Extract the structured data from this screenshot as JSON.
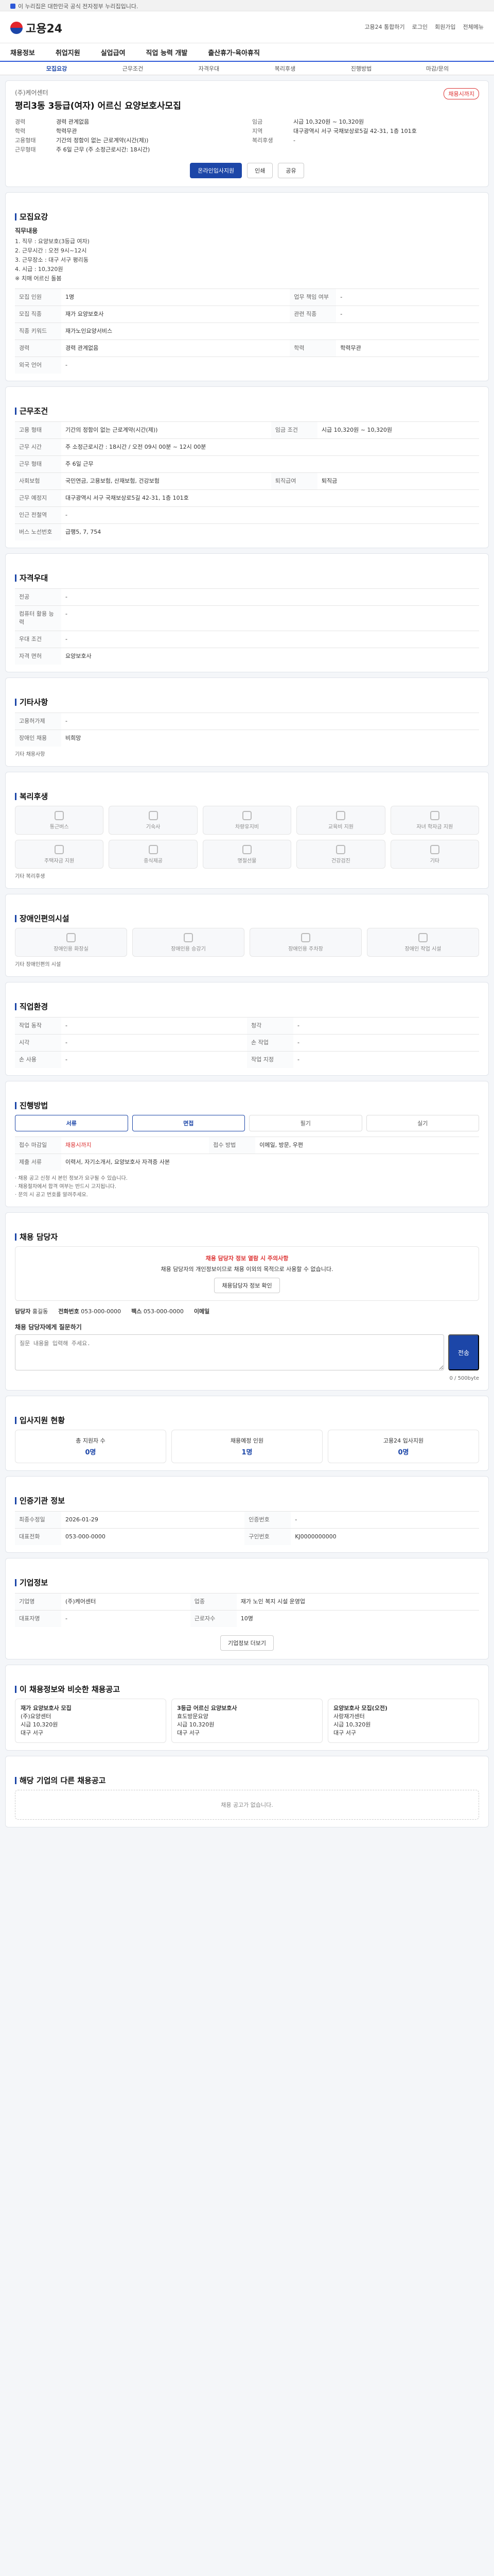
{
  "gov_bar": "이 누리집은 대한민국 공식 전자정부 누리집입니다.",
  "header": {
    "logo": "고용24",
    "links": [
      "고용24 통합하기",
      "로그인",
      "회원가입",
      "전체메뉴"
    ]
  },
  "gnb": [
    "채용정보",
    "취업지원",
    "실업급여",
    "직업 능력 개발",
    "출산휴가·육아휴직"
  ],
  "tabs": [
    "모집요강",
    "근무조건",
    "자격우대",
    "복리후생",
    "진행방법",
    "마감/문의"
  ],
  "job": {
    "company": "(주)케어센터",
    "title": "평리3동 3등급(여자) 어르신 요양보호사모집",
    "badge": "채용시까지",
    "left": [
      {
        "k": "지원자격",
        "v": ""
      },
      {
        "k": "경력",
        "v": "경력 관계없음"
      },
      {
        "k": "학력",
        "v": "학력무관"
      },
      {
        "k": "고용형태",
        "v": ""
      },
      {
        "k": "고용형태",
        "v": "기간의 정함이 없는 근로계약(시간(제))"
      },
      {
        "k": "근무형태",
        "v": "주 6일 근무 (주 소정근로시간: 18시간)"
      }
    ],
    "right": [
      {
        "k": "근무조건",
        "v": ""
      },
      {
        "k": "임금",
        "v": "시급 10,320원 ~ 10,320원"
      },
      {
        "k": "지역",
        "v": "대구광역시 서구 국채보상로5길 42-31, 1층 101호"
      },
      {
        "k": "복리후생",
        "v": ""
      }
    ],
    "btn_apply": "온라인입사지원",
    "btn_print": "인쇄",
    "btn_share": "공유"
  },
  "recruit": {
    "title": "모집요강",
    "duty_title": "직무내용",
    "duty": "1. 직무 : 요양보호(3등급 여자)\n2. 근무시간 : 오전 9시~12시\n3. 근무장소 : 대구 서구 평리동\n4. 시급 : 10,320원\n※ 치매 어르신 돌봄",
    "rows": [
      {
        "k": "모집 인원",
        "v": "1명",
        "k2": "업무 책임 여부",
        "v2": "-"
      },
      {
        "k": "모집 직종",
        "v": "재가 요양보호사",
        "k2": "관련 직종",
        "v2": "-"
      },
      {
        "k": "직종 키워드",
        "v": "재가노인요양서비스",
        "k2": "",
        "v2": ""
      },
      {
        "k": "경력",
        "v": "경력 관계없음",
        "k2": "학력",
        "v2": "학력무관"
      },
      {
        "k": "외국 언어",
        "v": "-",
        "k2": "",
        "v2": ""
      }
    ]
  },
  "cond": {
    "title": "근무조건",
    "rows": [
      {
        "k": "고용 형태",
        "v": "기간의 정함이 없는 근로계약(시간(제))"
      },
      {
        "k": "임금 조건",
        "v": "시급 10,320원 ~ 10,320원"
      },
      {
        "k": "근무 시간",
        "v": "주 소정근로시간 : 18시간 / 오전 09시 00분 ~ 12시 00분"
      },
      {
        "k": "근무 형태",
        "v": "주 6일 근무"
      },
      {
        "k": "사회보험",
        "v": "국민연금, 고용보험, 산재보험, 건강보험"
      },
      {
        "k": "퇴직급여",
        "v": "퇴직금"
      },
      {
        "k": "근무 예정지",
        "v": "대구광역시 서구 국채보상로5길 42-31, 1층 101호"
      },
      {
        "k": "인근 전철역",
        "v": "-"
      },
      {
        "k": "버스 노선번호",
        "v": "급행5, 7, 754"
      }
    ]
  },
  "qual": {
    "title": "자격우대",
    "rows": [
      {
        "k": "전공",
        "v": "-"
      },
      {
        "k": "컴퓨터 활용 능력",
        "v": "-"
      },
      {
        "k": "우대 조건",
        "v": "-"
      },
      {
        "k": "자격 면허",
        "v": "요양보호사"
      }
    ]
  },
  "etc": {
    "title": "기타사항",
    "rows": [
      {
        "k": "고용허가제",
        "v": "-"
      },
      {
        "k": "장애인 채용",
        "v": "비희망"
      }
    ],
    "note": "기타 채용사항"
  },
  "welfare": {
    "title": "복리후생",
    "items": [
      "통근버스",
      "기숙사",
      "차량유지비",
      "교육비 지원",
      "자녀 학자금 지원",
      "주택자금 지원",
      "중식제공",
      "명절선물",
      "건강검진",
      "기타"
    ],
    "etc_label": "기타 복리후생"
  },
  "disable": {
    "title": "장애인편의시설",
    "items": [
      "장애인용 화장실",
      "장애인용 승강기",
      "장애인용 주차장",
      "장애인 작업 시설"
    ],
    "etc_label": "기타 장애인편의 시설"
  },
  "info": {
    "title": "직업환경",
    "rows": [
      {
        "k": "작업 동작",
        "v": "-"
      },
      {
        "k": "청각",
        "v": "-"
      },
      {
        "k": "시각",
        "v": "-"
      },
      {
        "k": "손 작업",
        "v": "-"
      },
      {
        "k": "손 사용",
        "v": "-"
      },
      {
        "k": "작업 지정",
        "v": "-"
      }
    ]
  },
  "process": {
    "title": "진행방법",
    "steps": [
      "서류",
      "면접",
      "필기",
      "실기"
    ],
    "k1": "접수 마감일",
    "v1": "채용시까지",
    "k2": "접수 방법",
    "v2": "이메일, 방문, 우편",
    "k3": "제출 서류",
    "v3": "이력서, 자기소개서, 요양보호사 자격증 사본",
    "notes": [
      "· 채용 공고 신청 시 본인 정보가 요구될 수 있습니다.",
      "· 채용절차에서 합격 여부는 반드시 고지됩니다.",
      "· 문의 시 공고 번호를 알려주세요."
    ]
  },
  "contact": {
    "title": "채용 담당자",
    "warn": "채용 담당자 정보 열람 시 주의사항",
    "desc": "채용 담당자의 개인정보이므로 채용 이외의 목적으로 사용할 수 없습니다.",
    "btn": "채용담당자 정보 확인",
    "name_k": "담당자",
    "name_v": "홍길동",
    "tel_k": "전화번호",
    "tel_v": "053-000-0000",
    "fax_k": "팩스",
    "fax_v": "053-000-0000",
    "email_k": "이메일",
    "msg_title": "채용 담당자에게 질문하기",
    "msg_ph": "질문 내용을 입력해 주세요.",
    "count": "0 / 500byte",
    "send": "전송"
  },
  "status": {
    "title": "입사지원 현황",
    "items": [
      {
        "k": "총 지원자 수",
        "v": "0명"
      },
      {
        "k": "채용예정 인원",
        "v": "1명"
      },
      {
        "k": "고용24 입사지원",
        "v": "0명"
      }
    ]
  },
  "manage": {
    "title": "인증기관 정보",
    "rows": [
      {
        "k": "최종수정일",
        "v": "2026-01-29"
      },
      {
        "k": "인증번호",
        "v": "-"
      },
      {
        "k": "대표전화",
        "v": "053-000-0000"
      },
      {
        "k": "구인번호",
        "v": "KJ0000000000"
      }
    ]
  },
  "company": {
    "title": "기업정보",
    "rows": [
      {
        "k": "기업명",
        "v": "(주)케어센터"
      },
      {
        "k": "업종",
        "v": "재가 노인 복지 시설 운영업"
      },
      {
        "k": "대표자명",
        "v": "-"
      },
      {
        "k": "근로자수",
        "v": "10명"
      }
    ],
    "btn": "기업정보 더보기"
  },
  "similar": {
    "title": "이 채용정보와 비슷한 채용공고",
    "items": [
      {
        "t": "재가 요양보호사 모집",
        "c": "(주)요양센터",
        "w": "시급 10,320원",
        "l": "대구 서구"
      },
      {
        "t": "3등급 어르신 요양보호사",
        "c": "효도방문요양",
        "w": "시급 10,320원",
        "l": "대구 서구"
      },
      {
        "t": "요양보호사 모집(오전)",
        "c": "사랑재가센터",
        "w": "시급 10,320원",
        "l": "대구 서구"
      }
    ]
  },
  "empty": {
    "title": "해당 기업의 다른 채용공고",
    "msg": "채용 공고가 없습니다."
  }
}
